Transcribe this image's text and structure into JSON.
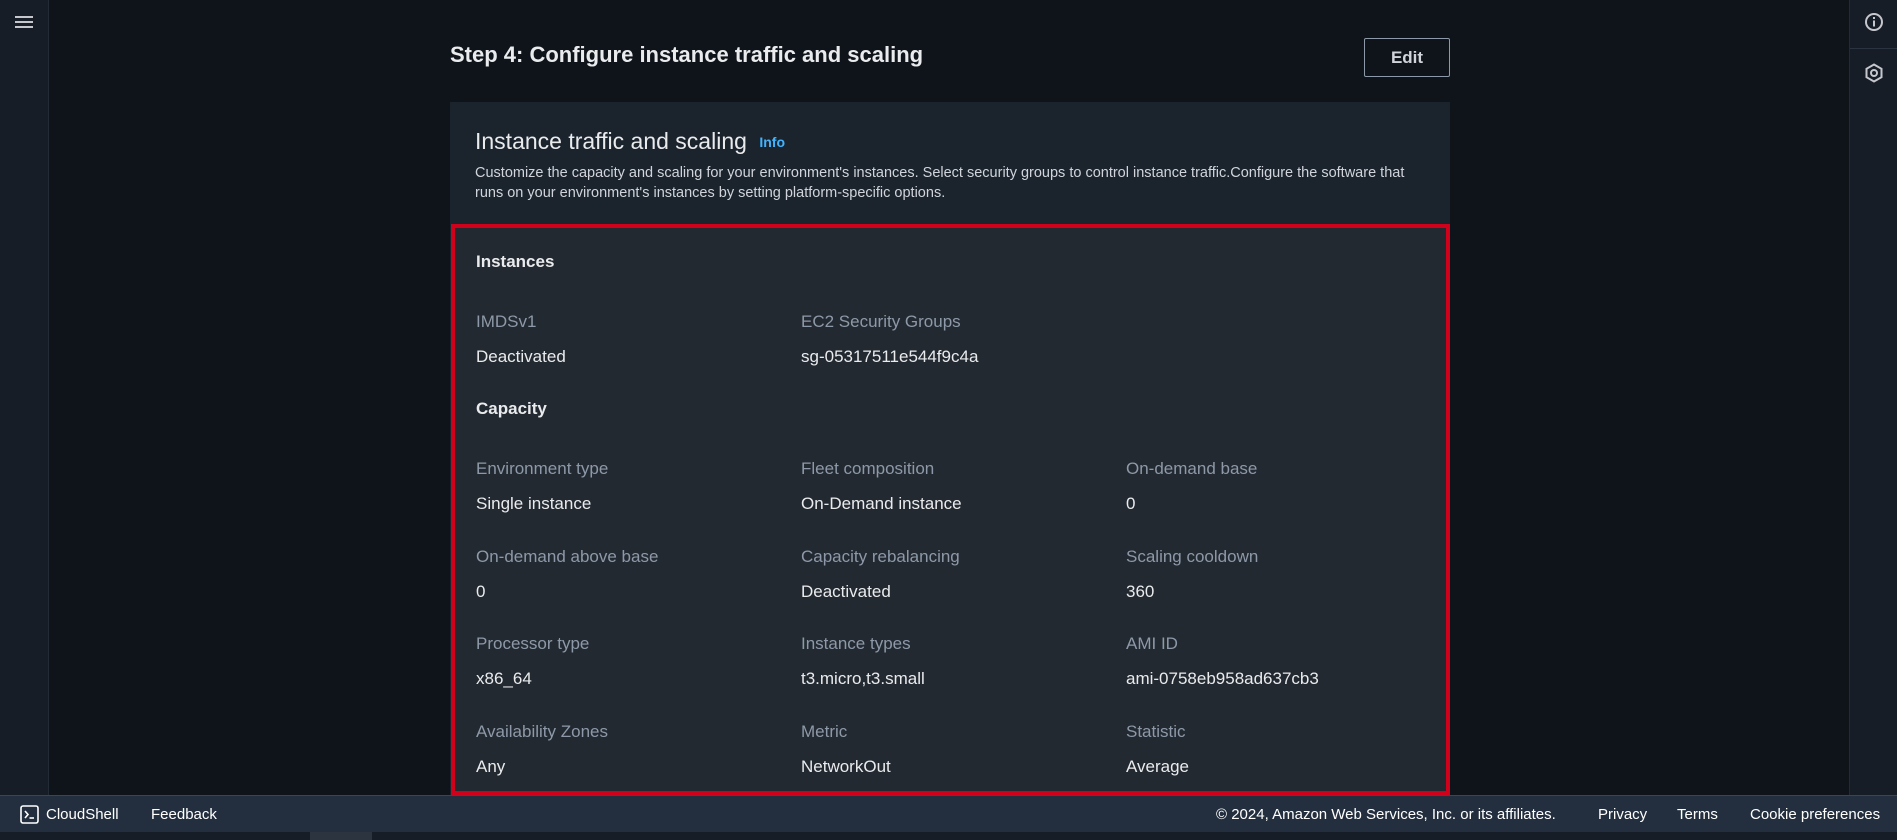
{
  "header": {
    "step_title": "Step 4: Configure instance traffic and scaling",
    "edit_label": "Edit"
  },
  "panel": {
    "title": "Instance traffic and scaling",
    "info_label": "Info",
    "description": "Customize the capacity and scaling for your environment's instances. Select security groups to control instance traffic.Configure the software that runs on your environment's instances by setting platform-specific options."
  },
  "instances": {
    "heading": "Instances",
    "fields": [
      {
        "label": "IMDSv1",
        "value": "Deactivated"
      },
      {
        "label": "EC2 Security Groups",
        "value": "sg-05317511e544f9c4a"
      }
    ]
  },
  "capacity": {
    "heading": "Capacity",
    "fields": [
      {
        "label": "Environment type",
        "value": "Single instance"
      },
      {
        "label": "Fleet composition",
        "value": "On-Demand instance"
      },
      {
        "label": "On-demand base",
        "value": "0"
      },
      {
        "label": "On-demand above base",
        "value": "0"
      },
      {
        "label": "Capacity rebalancing",
        "value": "Deactivated"
      },
      {
        "label": "Scaling cooldown",
        "value": "360"
      },
      {
        "label": "Processor type",
        "value": "x86_64"
      },
      {
        "label": "Instance types",
        "value": "t3.micro,t3.small"
      },
      {
        "label": "AMI ID",
        "value": "ami-0758eb958ad637cb3"
      },
      {
        "label": "Availability Zones",
        "value": "Any"
      },
      {
        "label": "Metric",
        "value": "NetworkOut"
      },
      {
        "label": "Statistic",
        "value": "Average"
      }
    ]
  },
  "footer": {
    "cloudshell": "CloudShell",
    "feedback": "Feedback",
    "copyright": "© 2024, Amazon Web Services, Inc. or its affiliates.",
    "privacy": "Privacy",
    "terms": "Terms",
    "cookie_preferences": "Cookie preferences"
  },
  "icons": {
    "menu": "hamburger-menu-icon",
    "info": "info-circle-icon",
    "notifications": "hexagon-gear-icon",
    "cloudshell": "terminal-icon"
  },
  "colors": {
    "highlight_border": "#d0021b",
    "link": "#42b4ff"
  }
}
